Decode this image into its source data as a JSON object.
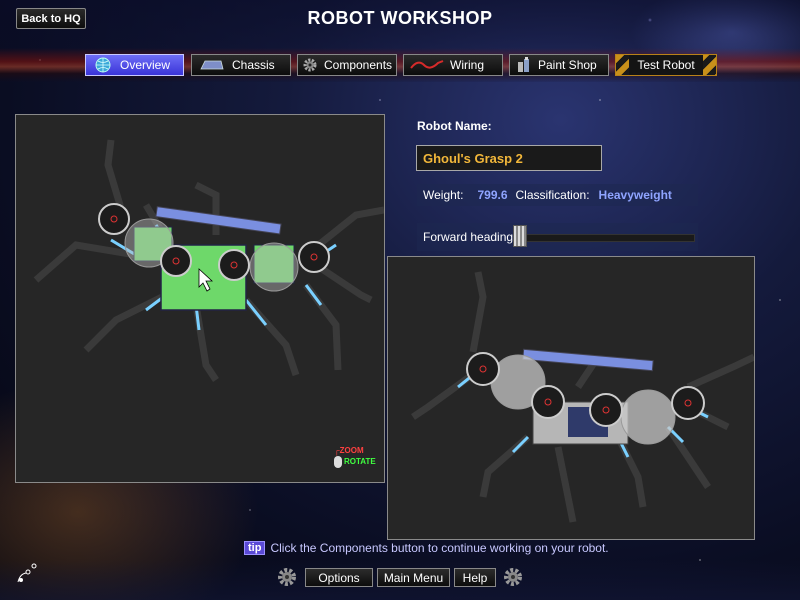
{
  "header": {
    "back_label": "Back to HQ",
    "title": "ROBOT WORKSHOP"
  },
  "tabs": [
    {
      "label": "Overview",
      "icon": "globe-icon",
      "active": true
    },
    {
      "label": "Chassis",
      "icon": "chassis-icon",
      "active": false
    },
    {
      "label": "Components",
      "icon": "gear-icon",
      "active": false
    },
    {
      "label": "Wiring",
      "icon": "wire-icon",
      "active": false
    },
    {
      "label": "Paint Shop",
      "icon": "paint-can-icon",
      "active": false
    },
    {
      "label": "Test Robot",
      "icon": "",
      "active": false
    }
  ],
  "viewport": {
    "zoom_hint": "ZOOM",
    "rotate_hint": "ROTATE"
  },
  "robot": {
    "name_label": "Robot Name:",
    "name": "Ghoul's Grasp 2",
    "weight_label": "Weight:",
    "weight": "799.6",
    "classification_label": "Classification:",
    "classification": "Heavyweight",
    "heading_label": "Forward heading:",
    "heading_value": 0
  },
  "tip": {
    "icon_text": "tip",
    "text": "Click the Components button to continue working on your robot."
  },
  "footer": {
    "options_label": "Options",
    "main_menu_label": "Main Menu",
    "help_label": "Help"
  },
  "colors": {
    "accent": "#4a44e6",
    "name_text": "#f2b73a",
    "value_text": "#8fa4ff",
    "zoom_hint": "#ff4040",
    "rotate_hint": "#40ff40"
  }
}
